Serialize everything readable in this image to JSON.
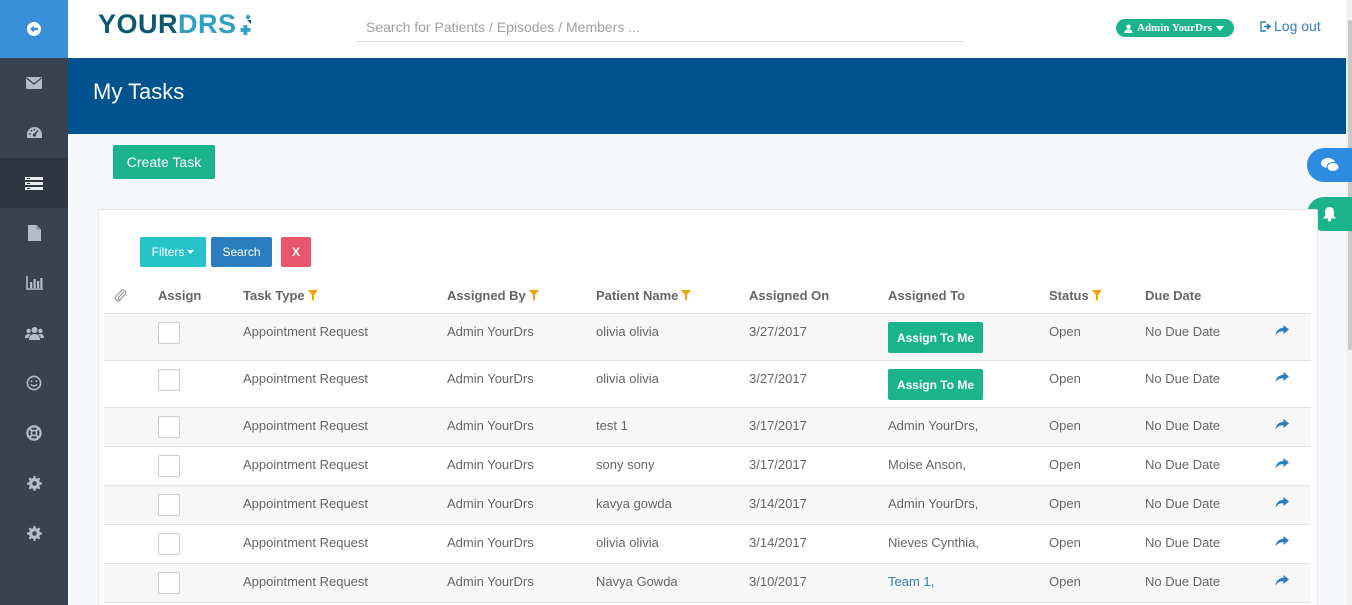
{
  "header": {
    "logo_main": "YOUR",
    "logo_accent": "DRS",
    "search_placeholder": "Search for Patients / Episodes / Members ...",
    "user_label": "Admin YourDrs",
    "logout_label": "Log out"
  },
  "banner": {
    "title": "My Tasks"
  },
  "toolbar": {
    "create_task": "Create Task",
    "filters": "Filters",
    "search": "Search",
    "clear": "X"
  },
  "table": {
    "headers": {
      "assign": "Assign",
      "task_type": "Task Type",
      "assigned_by": "Assigned By",
      "patient_name": "Patient Name",
      "assigned_on": "Assigned On",
      "assigned_to": "Assigned To",
      "status": "Status",
      "due_date": "Due Date"
    },
    "rows": [
      {
        "task_type": "Appointment Request",
        "assigned_by": "Admin YourDrs",
        "patient": "olivia olivia",
        "assigned_on": "3/27/2017",
        "assigned_to": "Assign To Me",
        "status": "Open",
        "due": "No Due Date"
      },
      {
        "task_type": "Appointment Request",
        "assigned_by": "Admin YourDrs",
        "patient": "olivia olivia",
        "assigned_on": "3/27/2017",
        "assigned_to": "Assign To Me",
        "status": "Open",
        "due": "No Due Date"
      },
      {
        "task_type": "Appointment Request",
        "assigned_by": "Admin YourDrs",
        "patient": "test 1",
        "assigned_on": "3/17/2017",
        "assigned_to": "Admin YourDrs,",
        "status": "Open",
        "due": "No Due Date"
      },
      {
        "task_type": "Appointment Request",
        "assigned_by": "Admin YourDrs",
        "patient": "sony sony",
        "assigned_on": "3/17/2017",
        "assigned_to": "Moise Anson,",
        "status": "Open",
        "due": "No Due Date"
      },
      {
        "task_type": "Appointment Request",
        "assigned_by": "Admin YourDrs",
        "patient": "kavya gowda",
        "assigned_on": "3/14/2017",
        "assigned_to": "Admin YourDrs,",
        "status": "Open",
        "due": "No Due Date"
      },
      {
        "task_type": "Appointment Request",
        "assigned_by": "Admin YourDrs",
        "patient": "olivia olivia",
        "assigned_on": "3/14/2017",
        "assigned_to": "Nieves Cynthia,",
        "status": "Open",
        "due": "No Due Date"
      },
      {
        "task_type": "Appointment Request",
        "assigned_by": "Admin YourDrs",
        "patient": "Navya Gowda",
        "assigned_on": "3/10/2017",
        "assigned_to": "Team 1,",
        "status": "Open",
        "due": "No Due Date"
      }
    ]
  },
  "colors": {
    "sidebar": "#3a4250",
    "banner": "#00538f",
    "accent_green": "#1bb38c",
    "accent_blue": "#2c7fbf",
    "filter_teal": "#26c3c9",
    "danger": "#e9556a",
    "funnel": "#f0a30a"
  },
  "icons": {
    "sidebar": [
      "back-circle-icon",
      "envelope-icon",
      "dashboard-icon",
      "tasks-list-icon",
      "document-icon",
      "bar-chart-icon",
      "users-icon",
      "smile-icon",
      "lifebuoy-icon",
      "gear-icon",
      "gear-icon"
    ],
    "row_action": "share-arrow-icon"
  }
}
